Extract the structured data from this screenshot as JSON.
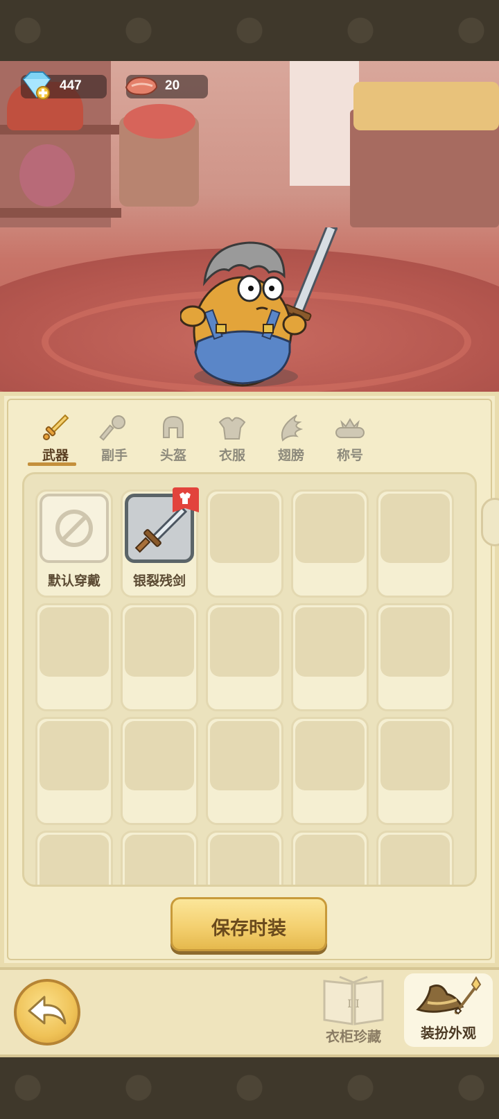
{
  "currencies": [
    {
      "name": "diamond",
      "icon": "diamond-plus-icon",
      "value": "447"
    },
    {
      "name": "meat",
      "icon": "meat-icon",
      "value": "20"
    }
  ],
  "tabs": [
    {
      "label": "武器",
      "icon": "sword-icon",
      "active": true
    },
    {
      "label": "副手",
      "icon": "offhand-icon",
      "active": false
    },
    {
      "label": "头盔",
      "icon": "helmet-icon",
      "active": false
    },
    {
      "label": "衣服",
      "icon": "armor-icon",
      "active": false
    },
    {
      "label": "翅膀",
      "icon": "wing-icon",
      "active": false
    },
    {
      "label": "称号",
      "icon": "title-crown-icon",
      "active": false
    }
  ],
  "slots": [
    {
      "label": "默认穿戴",
      "state": "default"
    },
    {
      "label": "银裂残剑",
      "state": "selected"
    }
  ],
  "save_button": "保存时装",
  "bottom_nav": {
    "wardrobe_label": "衣柜珍藏",
    "wardrobe_book_text": "I  I",
    "dress_label": "装扮外观"
  },
  "colors": {
    "accent": "#c4903c",
    "panel": "#f4ecc9",
    "badge": "#e2433c"
  }
}
